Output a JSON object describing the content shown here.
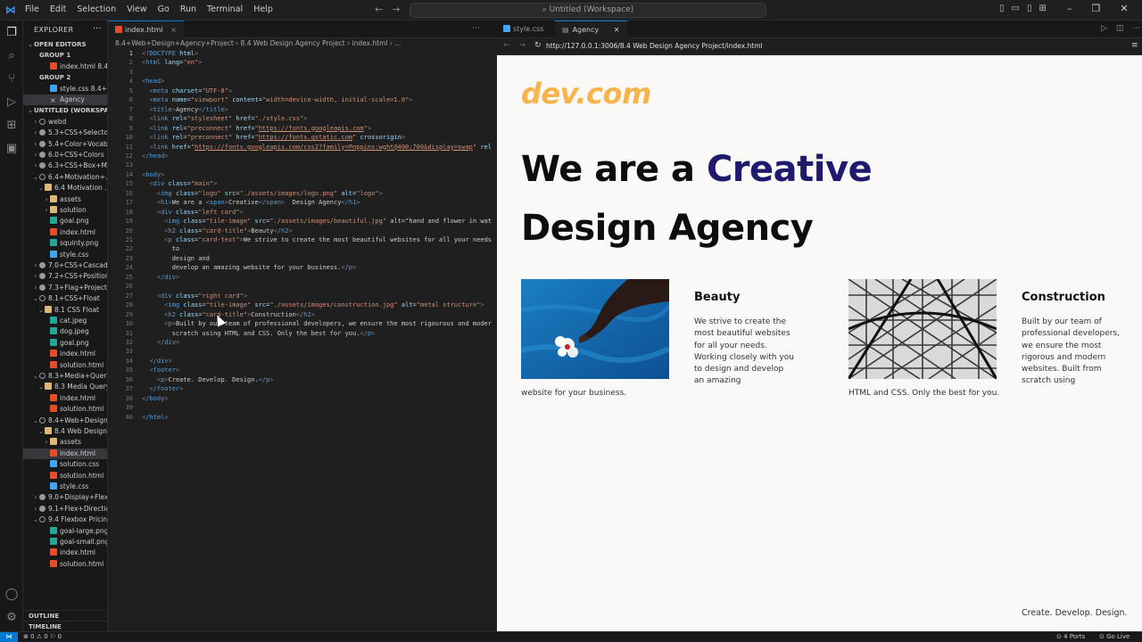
{
  "titlebar": {
    "menu": [
      "File",
      "Edit",
      "Selection",
      "View",
      "Go",
      "Run",
      "Terminal",
      "Help"
    ],
    "search": "Untitled (Workspace)"
  },
  "sidebar": {
    "header": "EXPLORER",
    "rows": [
      {
        "label": "OPEN EDITORS",
        "indent": 0,
        "kind": "section",
        "twisty": "⌄"
      },
      {
        "label": "GROUP 1",
        "indent": 1,
        "kind": "section",
        "twisty": ""
      },
      {
        "label": "index.html 8.4...",
        "indent": 3,
        "kind": "html",
        "twisty": ""
      },
      {
        "label": "GROUP 2",
        "indent": 1,
        "kind": "section",
        "twisty": ""
      },
      {
        "label": "style.css 8.4+We...",
        "indent": 3,
        "kind": "css",
        "twisty": ""
      },
      {
        "label": "Agency",
        "indent": 3,
        "kind": "close",
        "twisty": "",
        "selected": true
      },
      {
        "label": "UNTITLED (WORKSPACE)",
        "indent": 0,
        "kind": "section",
        "twisty": "⌄"
      },
      {
        "label": "webd",
        "indent": 1,
        "kind": "circle",
        "twisty": "›"
      },
      {
        "label": "5.3+CSS+Selectors",
        "indent": 1,
        "kind": "circlefull",
        "twisty": "›"
      },
      {
        "label": "5.4+Color+Vocab...",
        "indent": 1,
        "kind": "circlefull",
        "twisty": "›"
      },
      {
        "label": "6.0+CSS+Colors",
        "indent": 1,
        "kind": "circlefull",
        "twisty": "›"
      },
      {
        "label": "6.3+CSS+Box+M...",
        "indent": 1,
        "kind": "circlefull",
        "twisty": "›"
      },
      {
        "label": "6.4+Motivation+...",
        "indent": 1,
        "kind": "circle",
        "twisty": "⌄"
      },
      {
        "label": "6.4 Motivation ...",
        "indent": 2,
        "kind": "folder",
        "twisty": "⌄"
      },
      {
        "label": "assets",
        "indent": 3,
        "kind": "folder",
        "twisty": "›"
      },
      {
        "label": "solution",
        "indent": 3,
        "kind": "folder",
        "twisty": "›"
      },
      {
        "label": "goal.png",
        "indent": 3,
        "kind": "img",
        "twisty": ""
      },
      {
        "label": "index.html",
        "indent": 3,
        "kind": "html",
        "twisty": ""
      },
      {
        "label": "squinty.png",
        "indent": 3,
        "kind": "img",
        "twisty": ""
      },
      {
        "label": "style.css",
        "indent": 3,
        "kind": "css",
        "twisty": ""
      },
      {
        "label": "7.0+CSS+Cascade",
        "indent": 1,
        "kind": "circlefull",
        "twisty": "›"
      },
      {
        "label": "7.2+CSS+Position...",
        "indent": 1,
        "kind": "circlefull",
        "twisty": "›"
      },
      {
        "label": "7.3+Flag+Project",
        "indent": 1,
        "kind": "circlefull",
        "twisty": "›"
      },
      {
        "label": "8.1+CSS+Float",
        "indent": 1,
        "kind": "circle",
        "twisty": "⌄"
      },
      {
        "label": "8.1 CSS Float",
        "indent": 2,
        "kind": "folder",
        "twisty": "⌄"
      },
      {
        "label": "cat.jpeg",
        "indent": 3,
        "kind": "img",
        "twisty": ""
      },
      {
        "label": "dog.jpeg",
        "indent": 3,
        "kind": "img",
        "twisty": ""
      },
      {
        "label": "goal.png",
        "indent": 3,
        "kind": "img",
        "twisty": ""
      },
      {
        "label": "index.html",
        "indent": 3,
        "kind": "html",
        "twisty": ""
      },
      {
        "label": "solution.html",
        "indent": 3,
        "kind": "html",
        "twisty": ""
      },
      {
        "label": "8.3+Media+Query",
        "indent": 1,
        "kind": "circle",
        "twisty": "⌄"
      },
      {
        "label": "8.3 Media Query",
        "indent": 2,
        "kind": "folder",
        "twisty": "⌄"
      },
      {
        "label": "index.html",
        "indent": 3,
        "kind": "html",
        "twisty": ""
      },
      {
        "label": "solution.html",
        "indent": 3,
        "kind": "html",
        "twisty": ""
      },
      {
        "label": "8.4+Web+Design...",
        "indent": 1,
        "kind": "circle",
        "twisty": "⌄"
      },
      {
        "label": "8.4 Web Design ...",
        "indent": 2,
        "kind": "folder",
        "twisty": "⌄"
      },
      {
        "label": "assets",
        "indent": 3,
        "kind": "folder",
        "twisty": "›"
      },
      {
        "label": "index.html",
        "indent": 3,
        "kind": "html",
        "twisty": "",
        "selected": true
      },
      {
        "label": "solution.css",
        "indent": 3,
        "kind": "css",
        "twisty": ""
      },
      {
        "label": "solution.html",
        "indent": 3,
        "kind": "html",
        "twisty": ""
      },
      {
        "label": "style.css",
        "indent": 3,
        "kind": "css",
        "twisty": ""
      },
      {
        "label": "9.0+Display+Flex",
        "indent": 1,
        "kind": "circlefull",
        "twisty": "›"
      },
      {
        "label": "9.1+Flex+Direction",
        "indent": 1,
        "kind": "circlefull",
        "twisty": "›"
      },
      {
        "label": "9.4 Flexbox Pricin...",
        "indent": 1,
        "kind": "circle",
        "twisty": "⌄"
      },
      {
        "label": "goal-large.png",
        "indent": 3,
        "kind": "img",
        "twisty": ""
      },
      {
        "label": "goal-small.png",
        "indent": 3,
        "kind": "img",
        "twisty": ""
      },
      {
        "label": "index.html",
        "indent": 3,
        "kind": "html",
        "twisty": ""
      },
      {
        "label": "solution.html",
        "indent": 3,
        "kind": "html",
        "twisty": ""
      }
    ],
    "outline": "OUTLINE",
    "timeline": "TIMELINE"
  },
  "editor": {
    "tab": "index.html",
    "breadcrumb": "8.4+Web+Design+Agency+Project  ›  8.4 Web Design Agency Project  ›  index.html  ›  ...",
    "lines": [
      "<!DOCTYPE html>",
      "<html lang=\"en\">",
      "",
      "<head>",
      "  <meta charset=\"UTF-8\">",
      "  <meta name=\"viewport\" content=\"width=device-width, initial-scale=1.0\">",
      "  <title>Agency</title>",
      "  <link rel=\"stylesheet\" href=\"./style.css\">",
      "  <link rel=\"preconnect\" href=\"https://fonts.googleapis.com\">",
      "  <link rel=\"preconnect\" href=\"https://fonts.gstatic.com\" crossorigin>",
      "  <link href=\"https://fonts.googleapis.com/css2?family=Poppins:wght@400;700&display=swap\" rel",
      "</head>",
      "",
      "<body>",
      "  <div class=\"main\">",
      "    <img class=\"logo\" src=\"./assets/images/logo.png\" alt=\"logo\">",
      "    <h1>We are a <span>Creative</span>  Design Agency</h1>",
      "    <div class=\"left card\">",
      "      <img class=\"tile-image\" src=\"./assets/images/beautiful.jpg\" alt=\"hand and flower in wat",
      "      <h2 class=\"card-title\">Beauty</h2>",
      "      <p class=\"card-text\">We strive to create the most beautiful websites for all your needs",
      "        to",
      "        design and",
      "        develop an amazing website for your business.</p>",
      "    </div>",
      "",
      "    <div class=\"right card\">",
      "      <img class=\"tile-image\" src=\"./assets/images/construction.jpg\" alt=\"metal structure\">",
      "      <h2 class=\"card-title\">Construction</h2>",
      "      <p>Built by our team of professional developers, we ensure the most rigourous and moder",
      "        scratch using HTML and CSS. Only the best for you.</p>",
      "    </div>",
      "",
      "  </div>",
      "  <footer>",
      "    <p>Create. Develop. Design.</p>",
      "  </footer>",
      "</body>",
      "",
      "</html>"
    ]
  },
  "browser": {
    "tabs": [
      "style.css",
      "Agency"
    ],
    "url": "http://127.0.0.1:3006/8.4 Web Design Agency Project/index.html",
    "page": {
      "logo": "dev.com",
      "h1_before": "We are a ",
      "h1_span": "Creative",
      "h1_after": "Design Agency",
      "left_card": {
        "title": "Beauty",
        "text": "We strive to create the most beautiful websites for all your needs. Working closely with you to design and develop an amazing",
        "tail": "website for your business."
      },
      "right_card": {
        "title": "Construction",
        "text": "Built by our team of professional developers, we ensure the most rigorous and modern websites. Built from scratch using",
        "tail": "HTML and CSS. Only the best for you."
      },
      "footer": "Create. Develop. Design."
    }
  },
  "statusbar": {
    "left": "⊗ 0 ⚠ 0   ⚐ 0",
    "ports": "⊙ 4 Ports",
    "golive": "⊙ Go Live"
  },
  "colors": {
    "accent": "#0078d4",
    "logo": "#f8b34b",
    "creative": "#1e1a6e"
  }
}
